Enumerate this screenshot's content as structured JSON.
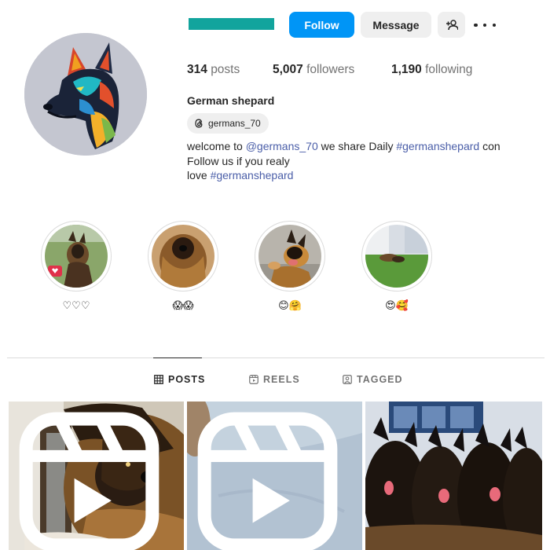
{
  "header": {
    "follow_label": "Follow",
    "message_label": "Message",
    "add_user_icon": "person-add-icon",
    "more_icon": "more-options-icon",
    "username_redacted_color": "#12a49d"
  },
  "stats": {
    "posts_count": "314",
    "posts_label": "posts",
    "followers_count": "5,007",
    "followers_label": "followers",
    "following_count": "1,190",
    "following_label": "following"
  },
  "profile": {
    "full_name": "German shepard",
    "threads_handle": "germans_70",
    "bio_line1_prefix": "welcome to ",
    "bio_line1_mention": "@germans_70",
    "bio_line1_middle": " we share Daily ",
    "bio_line1_hashtag": "#germanshepard",
    "bio_line1_suffix": " con",
    "bio_line2": "Follow us if you realy",
    "bio_line3_prefix": "love ",
    "bio_line3_hashtag": "#germanshepard"
  },
  "highlights": [
    {
      "label": "♡♡♡"
    },
    {
      "label": "😱😱"
    },
    {
      "label": "😊🤗"
    },
    {
      "label": "😍🥰"
    }
  ],
  "tabs": [
    {
      "label": "POSTS",
      "icon": "grid-icon",
      "active": true
    },
    {
      "label": "REELS",
      "icon": "reels-icon",
      "active": false
    },
    {
      "label": "TAGGED",
      "icon": "tagged-icon",
      "active": false
    }
  ],
  "colors": {
    "accent": "#0095f6",
    "link": "#4a5ea8",
    "button_bg": "#efefef"
  }
}
